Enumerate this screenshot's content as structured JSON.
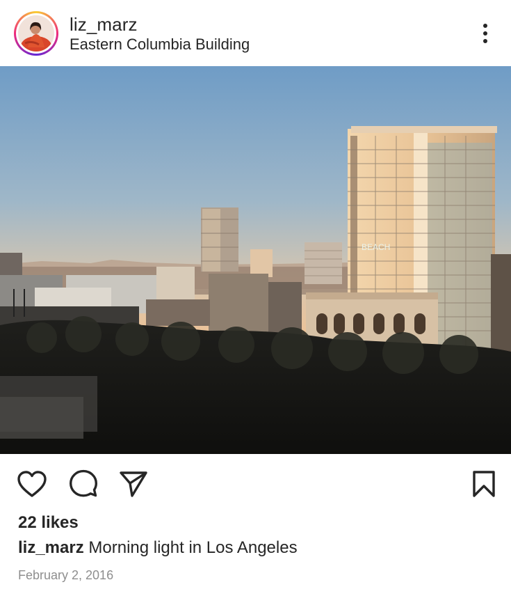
{
  "header": {
    "username": "liz_marz",
    "location": "Eastern Columbia Building",
    "avatar_icon": "profile-photo",
    "more_icon": "more-vertical-icon"
  },
  "photo": {
    "description_icon": "city-skyline-photo",
    "building_sign": "BEACH"
  },
  "actions": {
    "like_icon": "heart-icon",
    "comment_icon": "comment-icon",
    "share_icon": "send-icon",
    "save_icon": "bookmark-icon"
  },
  "likes": "22 likes",
  "caption": {
    "user": "liz_marz",
    "text": "Morning light in Los Angeles"
  },
  "date": "February 2, 2016",
  "colors": {
    "text": "#262626",
    "muted": "#8e8e8e",
    "ring_start": "#f9ce34",
    "ring_mid": "#ee2a7b"
  }
}
